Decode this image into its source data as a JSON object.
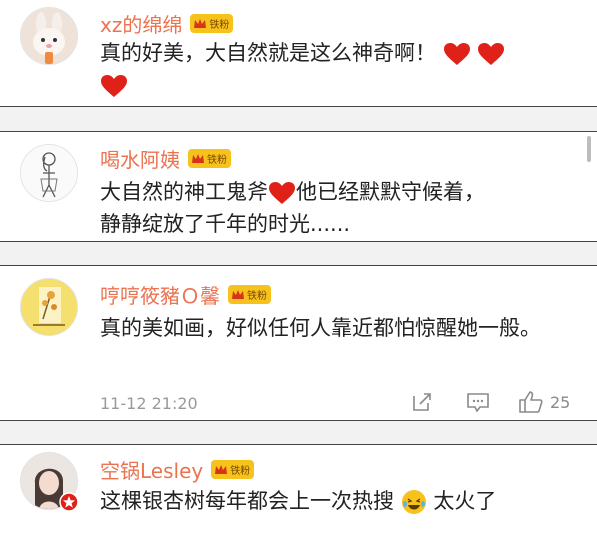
{
  "comments": [
    {
      "username": "xz的绵绵",
      "badge": "铁粉",
      "text": "真的好美，大自然就是这么神奇啊！",
      "avatar_icon": "bunny-avatar"
    },
    {
      "username": "喝水阿姨",
      "badge": "铁粉",
      "text_part1": "大自然的神工鬼斧",
      "text_part2": "他已经默默守候着，",
      "text_part3": "静静绽放了千年的时光......",
      "avatar_icon": "sketch-figure-avatar"
    },
    {
      "username": "哼哼筱豬Ｏ馨",
      "badge": "铁粉",
      "text": "真的美如画，好似任何人靠近都怕惊醒她一般。",
      "time": "11-12 21:20",
      "like_count": "25",
      "avatar_icon": "flower-painting-avatar"
    },
    {
      "username": "空锅Lesley",
      "badge": "铁粉",
      "text_part1": "这棵银杏树每年都会上一次热搜",
      "text_part2": "太火了",
      "avatar_icon": "woman-portrait-avatar"
    }
  ],
  "colors": {
    "username": "#eb7350",
    "badge": "#f7c21b",
    "heart": "#e0211a",
    "meta": "#9a9a9a"
  }
}
